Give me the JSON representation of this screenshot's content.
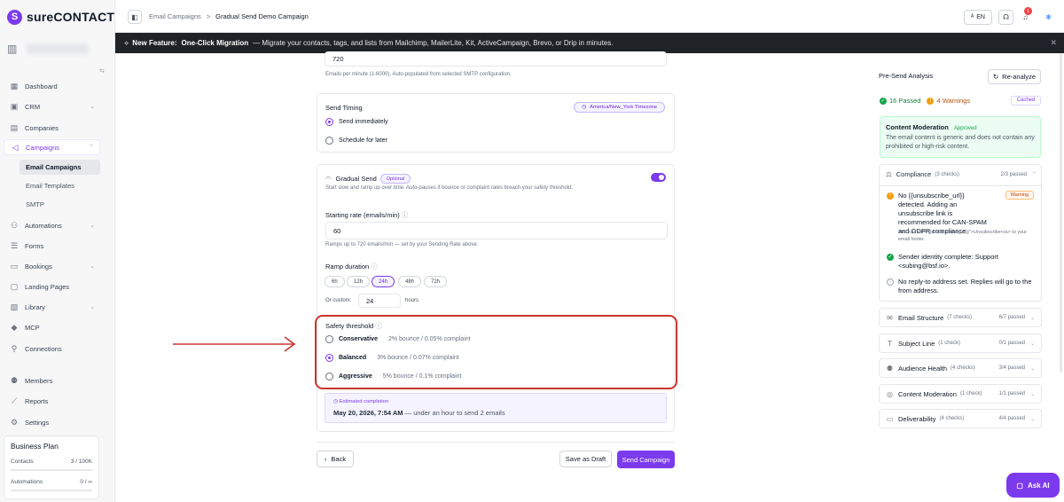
{
  "app": {
    "logo_text": "sureCONTACT"
  },
  "sidebar": {
    "items": [
      {
        "label": "Dashboard",
        "icon": "dashboard-icon"
      },
      {
        "label": "CRM",
        "icon": "crm-icon"
      },
      {
        "label": "Companies",
        "icon": "building-icon"
      },
      {
        "label": "Campaigns",
        "icon": "megaphone-icon"
      },
      {
        "label": "Automations",
        "icon": "automation-icon"
      },
      {
        "label": "Forms",
        "icon": "form-icon"
      },
      {
        "label": "Bookings",
        "icon": "calendar-icon"
      },
      {
        "label": "Landing Pages",
        "icon": "layout-icon"
      },
      {
        "label": "Library",
        "icon": "library-icon"
      },
      {
        "label": "MCP",
        "icon": "mcp-icon"
      },
      {
        "label": "Connections",
        "icon": "plug-icon"
      },
      {
        "label": "Members",
        "icon": "users-icon"
      },
      {
        "label": "Reports",
        "icon": "chart-icon"
      },
      {
        "label": "Settings",
        "icon": "gear-icon"
      }
    ],
    "sub_items": [
      "Email Campaigns",
      "Email Templates",
      "SMTP"
    ],
    "plan": {
      "title": "Business Plan",
      "contacts_label": "Contacts",
      "contacts_value": "3 / 100K",
      "automations_label": "Automations",
      "automations_value": "0 / ∞"
    }
  },
  "header": {
    "crumb_parent": "Email Campaigns",
    "crumb_sep": ">",
    "crumb_current": "Gradual Send Demo Campaign",
    "lang": "EN",
    "notif_count": "1"
  },
  "banner": {
    "label": "New Feature:",
    "title": "One-Click Migration",
    "text": "— Migrate your contacts, tags, and lists from Mailchimp, MailerLite, Kit, ActiveCampaign, Brevo, or Drip in minutes."
  },
  "rate": {
    "value": "720",
    "help": "Emails per minute (1-6000). Auto-populated from selected SMTP configuration."
  },
  "timing": {
    "title": "Send Timing",
    "timezone": "America/New_York Timezone",
    "opt_immediate": "Send immediately",
    "opt_schedule": "Schedule for later"
  },
  "gradual": {
    "title": "Gradual Send",
    "optional": "Optional",
    "desc": "Start slow and ramp up over time. Auto-pauses if bounce or complaint rates breach your safety threshold.",
    "start_label": "Starting rate (emails/min)",
    "start_value": "60",
    "start_help": "Ramps up to 720 emails/min — set by your Sending Rate above.",
    "ramp_label": "Ramp duration",
    "ramp_options": [
      "6h",
      "12h",
      "24h",
      "48h",
      "72h"
    ],
    "ramp_selected": "24h",
    "custom_label": "Or custom:",
    "custom_value": "24",
    "custom_unit": "hours",
    "threshold_label": "Safety threshold",
    "thresholds": [
      {
        "name": "Conservative",
        "desc": "2% bounce / 0.05% complaint"
      },
      {
        "name": "Balanced",
        "desc": "3% bounce / 0.07% complaint"
      },
      {
        "name": "Aggressive",
        "desc": "5% bounce / 0.1% complaint"
      }
    ],
    "est_label": "Estimated completion",
    "est_date": "May 20, 2026, 7:54 AM",
    "est_note": "— under an hour to send 2 emails"
  },
  "actions": {
    "back": "Back",
    "draft": "Save as Draft",
    "send": "Send Campaign"
  },
  "analysis": {
    "title": "Pre-Send Analysis",
    "reanalyze": "Re-analyze",
    "passed": "16 Passed",
    "warnings": "4 Warnings",
    "cached": "Cached",
    "moderation_title": "Content Moderation",
    "moderation_status": "Approved",
    "moderation_text": "The email content is generic and does not contain any prohibited or high-risk content.",
    "compliance": {
      "title": "Compliance",
      "count": "(3 checks)",
      "passed": "2/3 passed",
      "warn_text": "No {{unsubscribe_url}} detected. Adding an unsubscribe link is recommended for CAN-SPAM and GDPR compliance.",
      "warn_tag": "Warning",
      "warn_hint": "Add <a href=\"{{unsubscribe_url}}\">Unsubscribe</a> to your email footer.",
      "ok_text": "Sender identity complete: Support <subing@bsf.io>.",
      "info_text": "No reply-to address set. Replies will go to the from address."
    },
    "sections": [
      {
        "title": "Email Structure",
        "count": "(7 checks)",
        "passed": "6/7 passed",
        "icon": "envelope-icon"
      },
      {
        "title": "Subject Line",
        "count": "(1 check)",
        "passed": "0/1 passed",
        "icon": "text-icon"
      },
      {
        "title": "Audience Health",
        "count": "(4 checks)",
        "passed": "3/4 passed",
        "icon": "users-icon"
      },
      {
        "title": "Content Moderation",
        "count": "(1 check)",
        "passed": "1/1 passed",
        "icon": "shield-icon"
      },
      {
        "title": "Deliverability",
        "count": "(4 checks)",
        "passed": "4/4 passed",
        "icon": "inbox-icon"
      }
    ]
  },
  "ask_ai": "Ask AI",
  "colors": {
    "accent": "#7c3aed",
    "highlight": "#c8362e",
    "success": "#16a34a",
    "warning": "#f59e0b"
  }
}
